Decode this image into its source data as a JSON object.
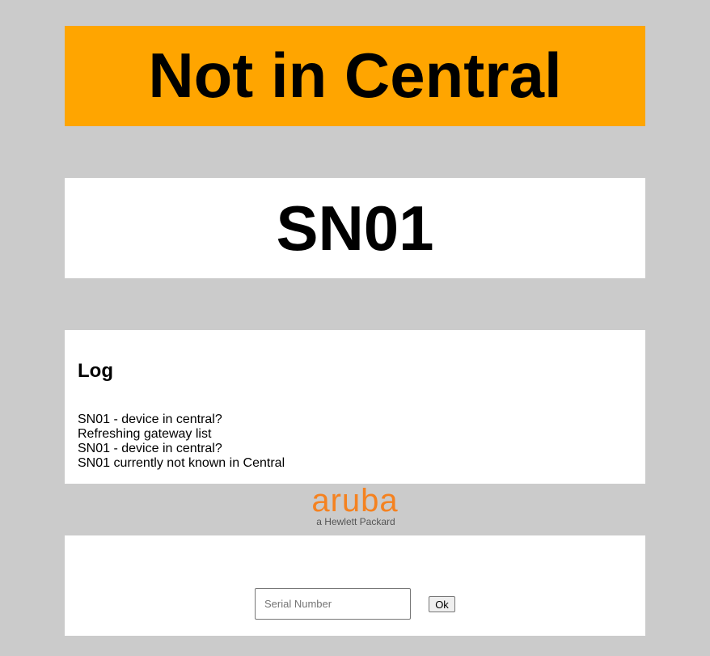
{
  "status_banner": {
    "text": "Not in Central",
    "background_color": "#ffa500"
  },
  "serial_display": {
    "text": "SN01"
  },
  "log": {
    "title": "Log",
    "entries": [
      "SN01 - device in central?",
      "Refreshing gateway list",
      "SN01 - device in central?",
      "SN01 currently not known in Central"
    ]
  },
  "logo": {
    "wordmark": "aruba",
    "tagline": "a Hewlett Packard",
    "color": "#f58220"
  },
  "form": {
    "serial_placeholder": "Serial Number",
    "serial_value": "",
    "ok_label": "Ok"
  }
}
